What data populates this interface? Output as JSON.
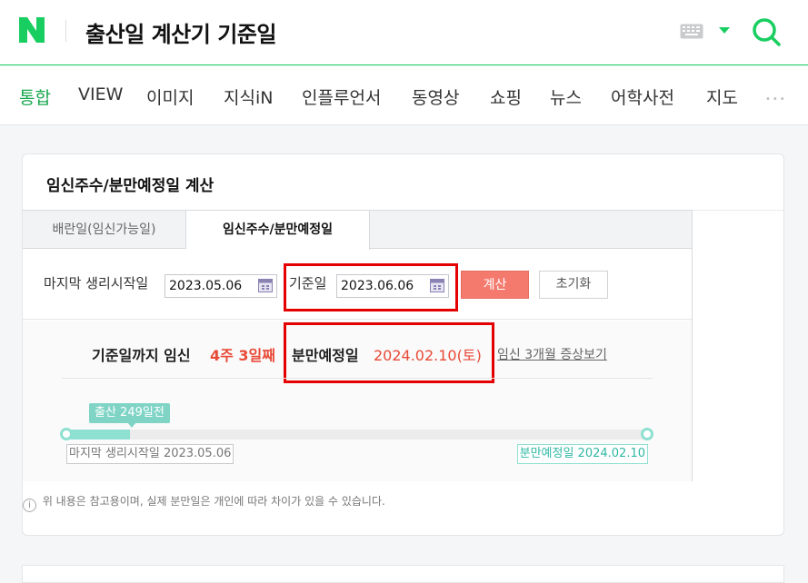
{
  "header": {
    "query": "출산일 계산기 기준일",
    "logo_letter": "N",
    "accent": "#19ce60"
  },
  "tabs": [
    "통합",
    "VIEW",
    "이미지",
    "지식iN",
    "인플루언서",
    "동영상",
    "쇼핑",
    "뉴스",
    "어학사전",
    "지도"
  ],
  "more_label": "•••",
  "card": {
    "title": "임신주수/분만예정일 계산",
    "subtabs": [
      "배란일(임신가능일)",
      "임신주수/분만예정일"
    ],
    "form": {
      "last_period_label": "마지막 생리시작일",
      "last_period_value": "2023.05.06",
      "base_date_label": "기준일",
      "base_date_value": "2023.06.06",
      "calc_button": "계산",
      "reset_button": "초기화"
    },
    "result": {
      "prefix": "기준일까지 임신",
      "weeks": "4주 3일째",
      "due_label": "분만예정일",
      "due_date": "2024.02.10(토)",
      "link": "임신 3개월 증상보기"
    },
    "timeline": {
      "tooltip": "출산 249일전",
      "start_label": "마지막 생리시작일 2023.05.06",
      "end_label": "분만예정일 2024.02.10",
      "progress_fraction": 0.11
    },
    "notice": "위 내용은 참고용이며, 실제 분만일은 개인에 따라 차이가 있을 수 있습니다.",
    "info_glyph": "i"
  }
}
